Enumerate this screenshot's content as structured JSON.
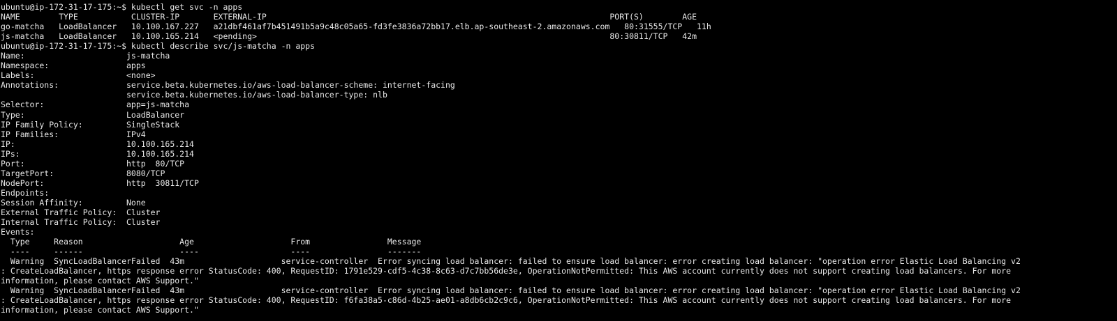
{
  "terminal": {
    "lines": [
      "ubuntu@ip-172-31-17-175:~$ kubectl get svc -n apps",
      "NAME        TYPE           CLUSTER-IP       EXTERNAL-IP                                                                       PORT(S)        AGE",
      "go-matcha   LoadBalancer   10.100.167.227   a21dbf461af7b451491b5a9c48c05a65-fd3fe3836a72bb17.elb.ap-southeast-2.amazonaws.com   80:31555/TCP   11h",
      "js-matcha   LoadBalancer   10.100.165.214   <pending>                                                                         80:30811/TCP   42m",
      "ubuntu@ip-172-31-17-175:~$ kubectl describe svc/js-matcha -n apps",
      "Name:                     js-matcha",
      "Namespace:                apps",
      "Labels:                   <none>",
      "Annotations:              service.beta.kubernetes.io/aws-load-balancer-scheme: internet-facing",
      "                          service.beta.kubernetes.io/aws-load-balancer-type: nlb",
      "Selector:                 app=js-matcha",
      "Type:                     LoadBalancer",
      "IP Family Policy:         SingleStack",
      "IP Families:              IPv4",
      "IP:                       10.100.165.214",
      "IPs:                      10.100.165.214",
      "Port:                     http  80/TCP",
      "TargetPort:               8080/TCP",
      "NodePort:                 http  30811/TCP",
      "Endpoints:",
      "Session Affinity:         None",
      "External Traffic Policy:  Cluster",
      "Internal Traffic Policy:  Cluster",
      "Events:",
      "  Type     Reason                    Age                    From                Message",
      "  ----     ------                    ----                   ----                -------",
      "  Warning  SyncLoadBalancerFailed  43m                    service-controller  Error syncing load balancer: failed to ensure load balancer: error creating load balancer: \"operation error Elastic Load Balancing v2",
      ": CreateLoadBalancer, https response error StatusCode: 400, RequestID: 1791e529-cdf5-4c38-8c63-d7c7bb56de3e, OperationNotPermitted: This AWS account currently does not support creating load balancers. For more",
      "information, please contact AWS Support.\"",
      "  Warning  SyncLoadBalancerFailed  43m                    service-controller  Error syncing load balancer: failed to ensure load balancer: error creating load balancer: \"operation error Elastic Load Balancing v2",
      ": CreateLoadBalancer, https response error StatusCode: 400, RequestID: f6fa38a5-c86d-4b25-ae01-a8db6cb2c9c6, OperationNotPermitted: This AWS account currently does not support creating load balancers. For more",
      "information, please contact AWS Support.\""
    ]
  }
}
